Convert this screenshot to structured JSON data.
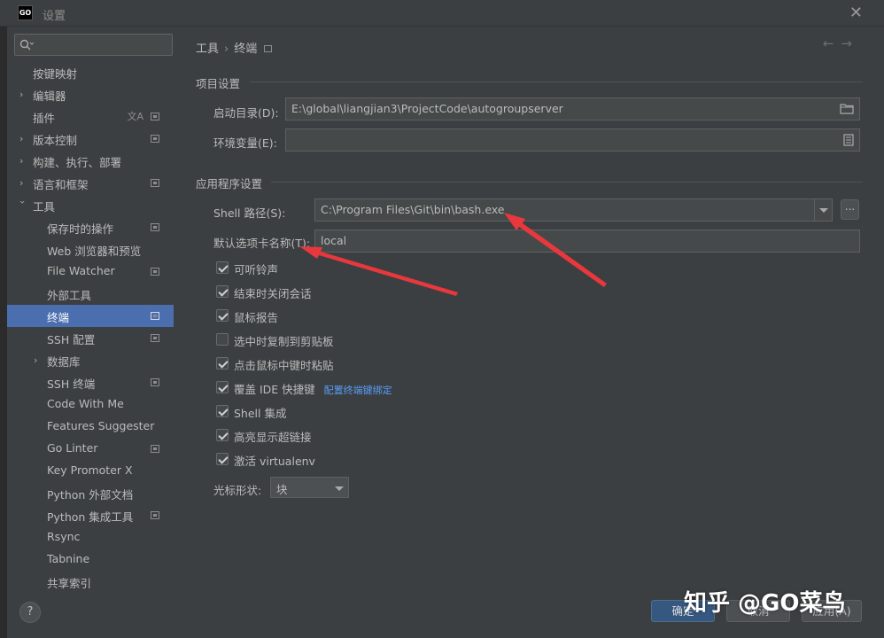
{
  "window": {
    "logo_text": "GO",
    "title": "设置"
  },
  "search": {
    "placeholder": ""
  },
  "sidebar": {
    "items": [
      {
        "label": "按键映射"
      },
      {
        "label": "编辑器"
      },
      {
        "label": "插件"
      },
      {
        "label": "版本控制"
      },
      {
        "label": "构建、执行、部署"
      },
      {
        "label": "语言和框架"
      },
      {
        "label": "工具"
      },
      {
        "label": "保存时的操作"
      },
      {
        "label": "Web 浏览器和预览"
      },
      {
        "label": "File Watcher"
      },
      {
        "label": "外部工具"
      },
      {
        "label": "终端"
      },
      {
        "label": "SSH 配置"
      },
      {
        "label": "数据库"
      },
      {
        "label": "SSH 终端"
      },
      {
        "label": "Code With Me"
      },
      {
        "label": "Features Suggester"
      },
      {
        "label": "Go Linter"
      },
      {
        "label": "Key Promoter X"
      },
      {
        "label": "Python 外部文档"
      },
      {
        "label": "Python 集成工具"
      },
      {
        "label": "Rsync"
      },
      {
        "label": "Tabnine"
      },
      {
        "label": "共享索引"
      }
    ]
  },
  "breadcrumb": {
    "parent": "工具",
    "current": "终端"
  },
  "project_settings": {
    "heading": "项目设置",
    "start_dir_label": "启动目录(D):",
    "start_dir_value": "E:\\global\\liangjian3\\ProjectCode\\autogroupserver",
    "env_label": "环境变量(E):",
    "env_value": ""
  },
  "app_settings": {
    "heading": "应用程序设置",
    "shell_label": "Shell 路径(S):",
    "shell_value": "C:\\Program Files\\Git\\bin\\bash.exe",
    "dots_label": "...",
    "tab_name_label": "默认选项卡名称(T):",
    "tab_name_value": "local",
    "checkboxes": [
      {
        "label": "可听铃声",
        "checked": true
      },
      {
        "label": "结束时关闭会话",
        "checked": true
      },
      {
        "label": "鼠标报告",
        "checked": true
      },
      {
        "label": "选中时复制到剪贴板",
        "checked": false
      },
      {
        "label": "点击鼠标中键时粘贴",
        "checked": true
      },
      {
        "label": "覆盖 IDE 快捷键",
        "checked": true
      },
      {
        "label": "Shell 集成",
        "checked": true
      },
      {
        "label": "高亮显示超链接",
        "checked": true
      },
      {
        "label": "激活 virtualenv",
        "checked": true
      }
    ],
    "keybind_link": "配置终端键绑定",
    "cursor_label": "光标形状:",
    "cursor_value": "块"
  },
  "footer": {
    "help": "?",
    "ok": "确定",
    "cancel": "取消",
    "apply": "应用(A)"
  },
  "watermark": "知乎 @GO菜鸟",
  "colors": {
    "selection": "#4b6eaf",
    "annotation_arrow": "#e8383d",
    "link": "#589df6"
  }
}
